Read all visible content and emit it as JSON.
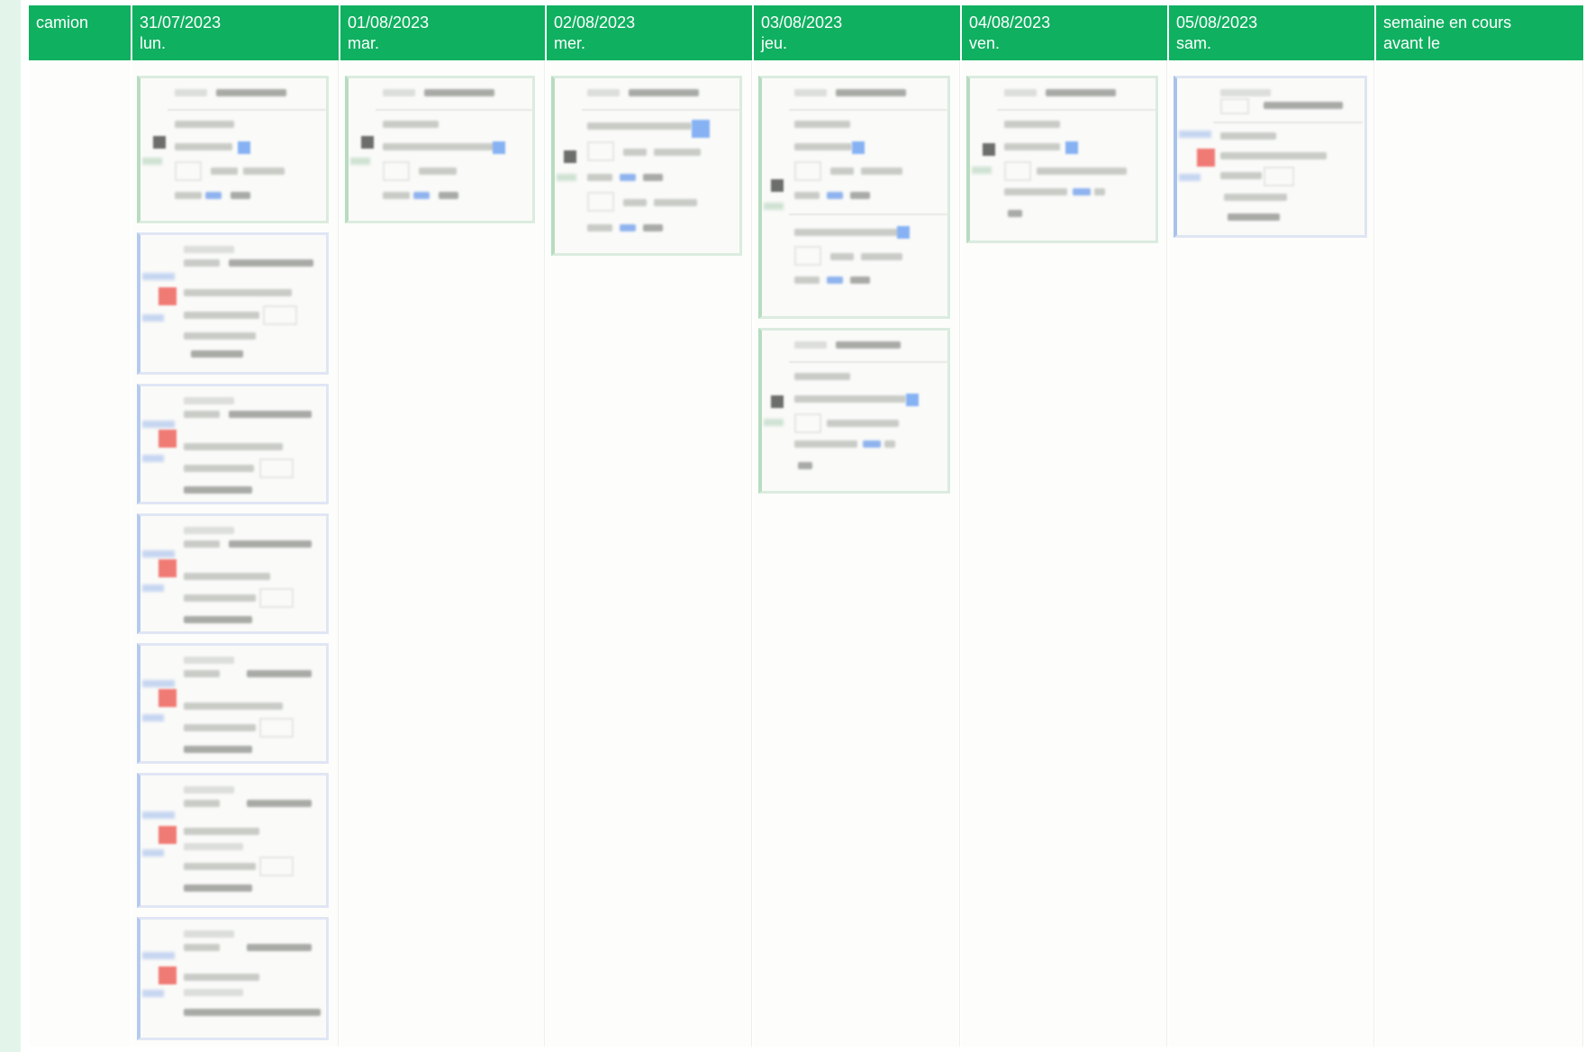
{
  "header": {
    "first_column": "camion",
    "days": [
      {
        "date": "31/07/2023",
        "weekday": "lun."
      },
      {
        "date": "01/08/2023",
        "weekday": "mar."
      },
      {
        "date": "02/08/2023",
        "weekday": "mer."
      },
      {
        "date": "03/08/2023",
        "weekday": "jeu."
      },
      {
        "date": "04/08/2023",
        "weekday": "ven."
      },
      {
        "date": "05/08/2023",
        "weekday": "sam."
      }
    ],
    "last_column": {
      "line1": "semaine en cours",
      "line2": "avant le"
    }
  },
  "colors": {
    "header_bg": "#0fb060",
    "header_text": "#ffffff",
    "page_bg": "#e3f5ea",
    "card_green_border": "#b8dcc0",
    "card_blue_border": "#a8c2ec",
    "status_red": "#f07a74",
    "status_blue": "#86b2f3"
  },
  "icons": {
    "truck": "truck-icon",
    "alert": "alert-icon",
    "info": "info-icon"
  }
}
